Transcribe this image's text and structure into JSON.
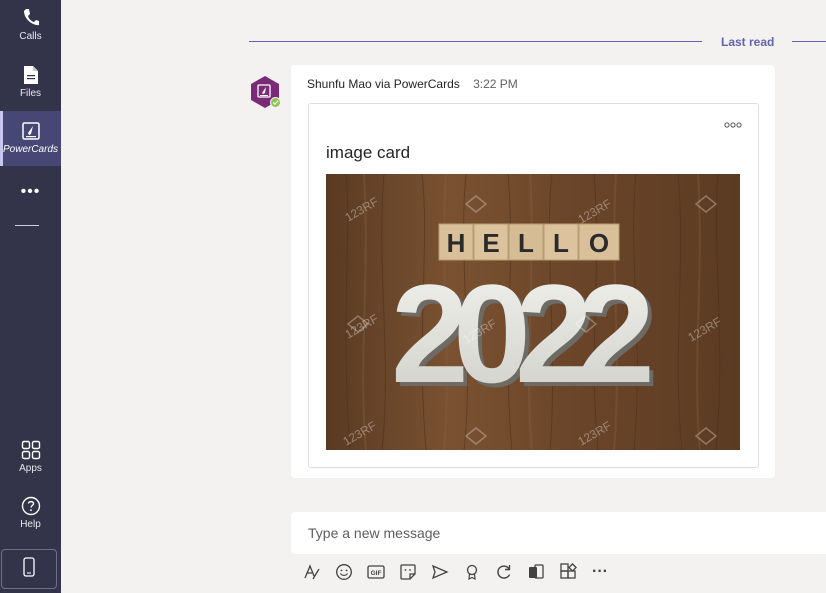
{
  "sidebar": {
    "items": [
      {
        "label": "Calls",
        "icon": "phone-icon"
      },
      {
        "label": "Files",
        "icon": "file-icon"
      },
      {
        "label": "PowerCards",
        "icon": "powercards-icon",
        "active": true
      },
      {
        "label": "Apps",
        "icon": "apps-icon"
      },
      {
        "label": "Help",
        "icon": "help-icon"
      }
    ],
    "more_label": "•••"
  },
  "chat": {
    "last_read_label": "Last read",
    "message": {
      "author": "Shunfu Mao via PowerCards",
      "time": "3:22 PM",
      "card": {
        "title": "image card",
        "image": {
          "top_word": "HELLO",
          "big_text": "2022",
          "watermark": "123RF"
        }
      }
    }
  },
  "compose": {
    "placeholder": "Type a new message"
  },
  "toolbar": {
    "format_icon": "format-icon",
    "emoji_icon": "emoji-icon",
    "gif_label": "GIF",
    "sticker_icon": "sticker-icon",
    "meet_icon": "send-arrow-icon",
    "praise_icon": "praise-icon",
    "loop_icon": "loop-icon",
    "approvals_icon": "approvals-icon",
    "apps_icon": "apps-icon",
    "more_label": "···"
  },
  "colors": {
    "rail": "#33344a",
    "rail_active": "#464775",
    "accent": "#6264a7",
    "avatar": "#7b2a78",
    "presence": "#92c353",
    "background": "#f3f2f1"
  }
}
